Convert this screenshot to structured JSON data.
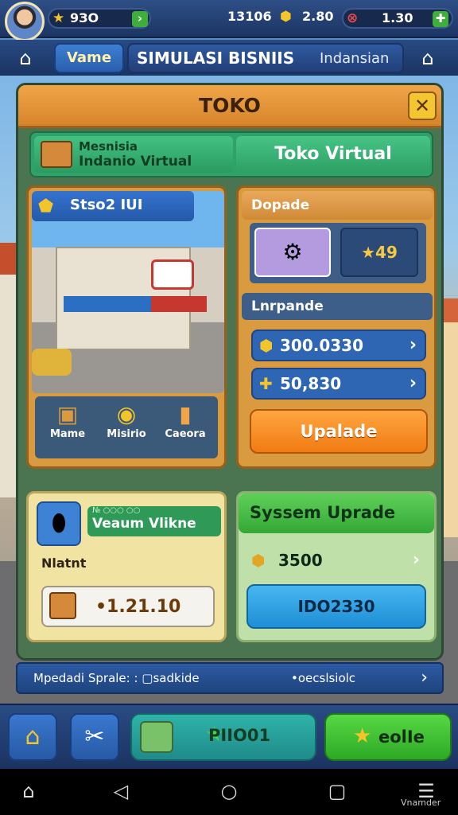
{
  "status_bar": {
    "star_value": "9ЗО",
    "coins_value": "13106",
    "gems_value": "2.80",
    "energy_value": "1.30"
  },
  "nav": {
    "name_pill": "Vame",
    "title": "SIMULASI BISNIIS",
    "subtitle": "Indansian"
  },
  "panel": {
    "title": "TOKO",
    "close_icon": "close-icon"
  },
  "tabs": [
    {
      "line1": "Mesnisia",
      "line2": "Indanio Virtual"
    },
    {
      "label": "Toko Virtual"
    }
  ],
  "store_card": {
    "badge": "Stso2 IUI",
    "items": [
      {
        "label": "Mame",
        "icon": "box-icon"
      },
      {
        "label": "Misirio",
        "icon": "camera-icon"
      },
      {
        "label": "Caeora",
        "icon": "bucket-icon"
      }
    ]
  },
  "upgrade_card": {
    "header": "Dopade",
    "star_value": "49",
    "subheader": "Lnrpande",
    "rows": [
      {
        "value": "300.0330"
      },
      {
        "value": "50,830"
      }
    ],
    "button": "Upalade"
  },
  "product_card": {
    "banner_small": "№ ○○○ ○○",
    "banner": "Veaum Vlikne",
    "label": "Nlatnt",
    "value": "•1.21.10"
  },
  "system_card": {
    "header": "Syssem Uprade",
    "value": "3500",
    "button": "IDO2З30"
  },
  "info_strip": {
    "left": "Mpedadi Sprale: : ▢sadkide",
    "right": "•oecslsiolc"
  },
  "action_bar": {
    "mid_value": "PIIO01",
    "right_label": "eolIe"
  },
  "system_nav": {
    "label": "Vnamder"
  },
  "colors": {
    "panel_header": "#e49a3f",
    "tab_green": "#2fa269",
    "upgrade_orange": "#f07b12",
    "system_green": "#35a736",
    "button_blue": "#1f8fd6"
  }
}
